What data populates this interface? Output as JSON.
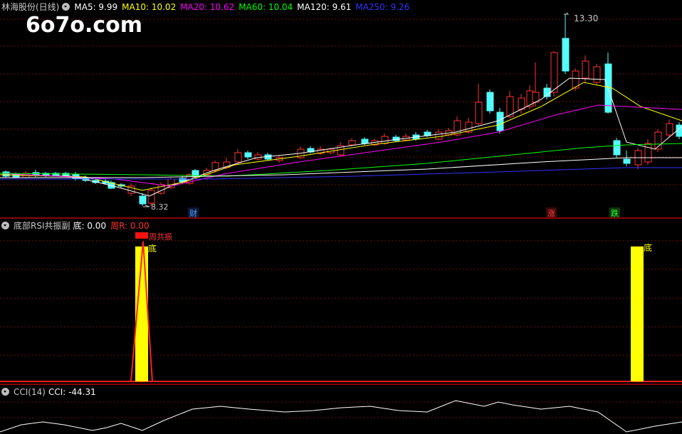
{
  "main": {
    "title": "林海股份(日线)",
    "indicators": [
      {
        "label": "MA5: 9.99",
        "color": "#ffffff"
      },
      {
        "label": "MA10: 10.02",
        "color": "#ffff00"
      },
      {
        "label": "MA20: 10.62",
        "color": "#ff00ff"
      },
      {
        "label": "MA60: 10.04",
        "color": "#00ff00"
      },
      {
        "label": "MA120: 9.61",
        "color": "#ffffff"
      },
      {
        "label": "MA250: 9.26",
        "color": "#3333ff"
      }
    ],
    "watermark": "6o7o.com",
    "high_label": "13.30",
    "low_label": "8.32",
    "markers": [
      {
        "text": "财",
        "color": "#4fa3ff"
      },
      {
        "text": "涨",
        "color": "#ff4040"
      },
      {
        "text": "跌",
        "color": "#33ff33"
      }
    ]
  },
  "rsi": {
    "title": "底部RSI共振副",
    "di_label": "底: 0.00",
    "zhou_label": "周R: 0.00",
    "annotation_zhou": "周共振",
    "annotation_di_1": "底",
    "annotation_di_2": "底"
  },
  "cci": {
    "title": "CCI(14)",
    "value_label": "CCI: -44.31"
  }
}
